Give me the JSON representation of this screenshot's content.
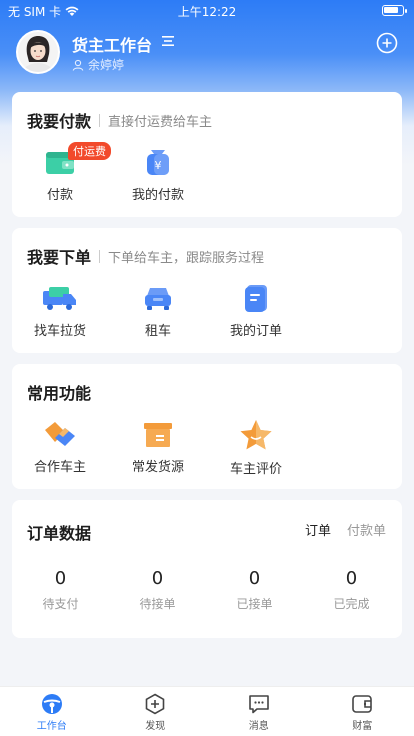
{
  "status_bar": {
    "carrier": "无 SIM 卡",
    "time": "上午12:22",
    "battery_level": 0.8
  },
  "header": {
    "title": "货主工作台",
    "user_name": "余婷婷",
    "icons": {
      "switch": "switch-role-icon",
      "user": "user-icon",
      "add": "add-circle-icon"
    }
  },
  "payment": {
    "title": "我要付款",
    "subtitle": "直接付运费给车主",
    "items": [
      {
        "label": "付款",
        "badge": "付运费",
        "icon": "wallet-icon"
      },
      {
        "label": "我的付款",
        "icon": "yuan-bag-icon"
      }
    ]
  },
  "order": {
    "title": "我要下单",
    "subtitle": "下单给车主，跟踪服务过程",
    "items": [
      {
        "label": "找车拉货",
        "icon": "truck-icon"
      },
      {
        "label": "租车",
        "icon": "car-icon"
      },
      {
        "label": "我的订单",
        "icon": "document-icon"
      }
    ]
  },
  "common": {
    "title": "常用功能",
    "items": [
      {
        "label": "合作车主",
        "icon": "handshake-icon"
      },
      {
        "label": "常发货源",
        "icon": "box-icon"
      },
      {
        "label": "车主评价",
        "icon": "star-icon"
      }
    ]
  },
  "stats": {
    "title": "订单数据",
    "tabs": [
      "订单",
      "付款单"
    ],
    "items": [
      {
        "value": "0",
        "label": "待支付"
      },
      {
        "value": "0",
        "label": "待接单"
      },
      {
        "value": "0",
        "label": "已接单"
      },
      {
        "value": "0",
        "label": "已完成"
      }
    ]
  },
  "tabbar": {
    "items": [
      {
        "label": "工作台",
        "icon": "steering-wheel-icon",
        "active": true
      },
      {
        "label": "发现",
        "icon": "discover-icon"
      },
      {
        "label": "消息",
        "icon": "message-icon"
      },
      {
        "label": "财富",
        "icon": "wallet-icon"
      }
    ]
  },
  "colors": {
    "primary": "#2d7cf6",
    "badge": "#f24a2b",
    "orange": "#f39b3a",
    "teal": "#3ccfa6"
  }
}
